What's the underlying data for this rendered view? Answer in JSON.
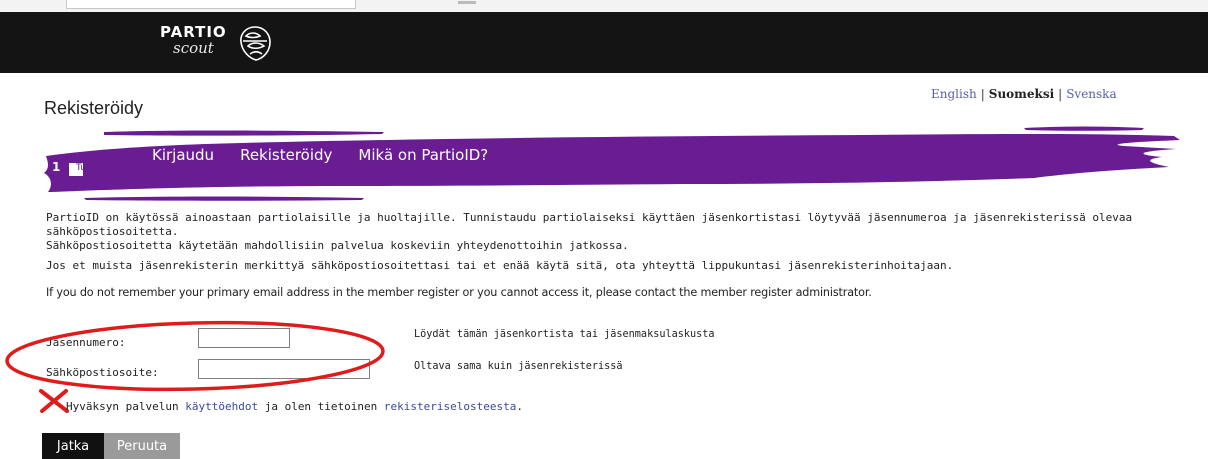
{
  "header": {
    "logo_top": "PARTIO",
    "logo_bottom": "scout"
  },
  "language": {
    "english": "English",
    "finnish": "Suomeksi",
    "swedish": "Svenska",
    "separator": "|"
  },
  "page": {
    "title": "Rekisteröidy"
  },
  "step": {
    "number": "1",
    "label": "Tu"
  },
  "nav": {
    "items": [
      {
        "label": "Kirjaudu"
      },
      {
        "label": "Rekisteröidy"
      },
      {
        "label": "Mikä on PartioID?"
      }
    ]
  },
  "info": {
    "p1_line1": "PartioID on käytössä ainoastaan partiolaisille ja huoltajille. Tunnistaudu partiolaiseksi käyttäen jäsenkortistasi löytyvää jäsennumeroa ja jäsenrekisterissä olevaa sähköpostiosoitetta.",
    "p1_line2": "Sähköpostiosoitetta käytetään mahdollisiin palvelua koskeviin yhteydenottoihin jatkossa.",
    "p2": "Jos et muista jäsenrekisterin merkittyä sähköpostiosoitettasi tai et enää käytä sitä, ota yhteyttä lippukuntasi jäsenrekisterinhoitajaan.",
    "p3": "If you do not remember your primary email address in the member register or you cannot access it, please contact the member register administrator."
  },
  "form": {
    "member_label": "Jäsennumero:",
    "member_value": "",
    "member_hint": "Löydät tämän jäsenkortista tai jäsenmaksulaskusta",
    "email_label": "Sähköpostiosoite:",
    "email_value": "",
    "email_hint": "Oltava sama kuin jäsenrekisterissä"
  },
  "terms": {
    "prefix": "Hyväksyn palvelun ",
    "link1": "käyttöehdot",
    "middle": " ja olen tietoinen ",
    "link2": "rekisteriselosteesta",
    "suffix": "."
  },
  "buttons": {
    "continue": "Jatka",
    "cancel": "Peruuta"
  },
  "colors": {
    "header_bg": "#141414",
    "brand_purple": "#6a1d93",
    "link": "#3a4aa0",
    "annotation_red": "#e01b1b"
  }
}
